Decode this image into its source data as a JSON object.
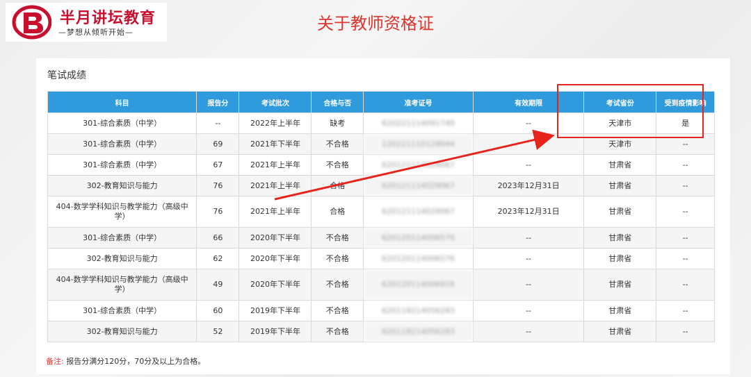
{
  "logo": {
    "name": "半月讲坛教育",
    "slogan": "—梦想从倾听开始—"
  },
  "page_title": "关于教师资格证",
  "section_title": "笔试成绩",
  "table": {
    "headers": [
      "科目",
      "报告分",
      "考试批次",
      "合格与否",
      "准考证号",
      "有效期限",
      "考试省份",
      "受到疫情影响"
    ],
    "rows": [
      [
        "301-综合素质（中学）",
        "--",
        "2022年上半年",
        "缺考",
        "620221114091740",
        "--",
        "天津市",
        "是"
      ],
      [
        "301-综合素质（中学）",
        "69",
        "2021年下半年",
        "不合格",
        "120221110128044",
        "",
        "天津市",
        "--"
      ],
      [
        "301-综合素质（中学）",
        "67",
        "2021年上半年",
        "不合格",
        "620121114029067",
        "--",
        "甘肃省",
        "--"
      ],
      [
        "302-教育知识与能力",
        "76",
        "2021年上半年",
        "合格",
        "620121114029067",
        "2023年12月31日",
        "甘肃省",
        "--"
      ],
      [
        "404-数学学科知识与教学能力（高级中学）",
        "76",
        "2021年上半年",
        "合格",
        "620121114029067",
        "2023年12月31日",
        "甘肃省",
        "--"
      ],
      [
        "301-综合素质（中学）",
        "66",
        "2020年下半年",
        "不合格",
        "620120114006570",
        "--",
        "甘肃省",
        "--"
      ],
      [
        "302-教育知识与能力",
        "62",
        "2020年下半年",
        "不合格",
        "620120114006576",
        "--",
        "甘肃省",
        "--"
      ],
      [
        "404-数学学科知识与教学能力（高级中学）",
        "49",
        "2020年下半年",
        "不合格",
        "620120114006916",
        "--",
        "甘肃省",
        "--"
      ],
      [
        "301-综合素质（中学）",
        "60",
        "2019年下半年",
        "不合格",
        "620119214056283",
        "--",
        "甘肃省",
        "--"
      ],
      [
        "302-教育知识与能力",
        "52",
        "2019年下半年",
        "不合格",
        "620119214056283",
        "--",
        "甘肃省",
        "--"
      ]
    ]
  },
  "note": {
    "label": "备注:",
    "text": "报告分满分120分，70分及以上为合格。"
  },
  "colors": {
    "header_bg": "#2f9bdc",
    "title_red": "#e0332b",
    "annotation_red": "#e8231c"
  }
}
